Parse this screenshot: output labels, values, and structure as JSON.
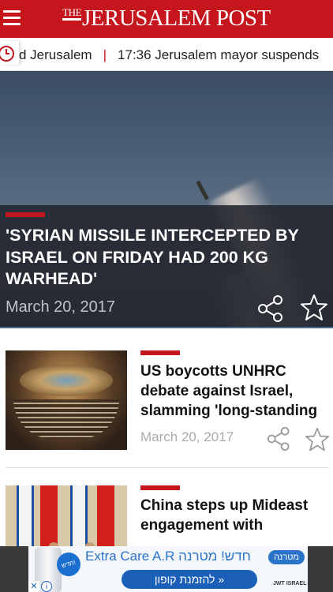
{
  "header": {
    "logo_the": "THE",
    "logo_name": "JERUSALEM POST"
  },
  "ticker": {
    "items": [
      "d Jerusalem",
      "17:36 Jerusalem mayor suspends"
    ]
  },
  "hero": {
    "title": "'Syrian missile intercepted by Israel on Friday had 200 kg warhead'",
    "date": "March 20, 2017"
  },
  "articles": [
    {
      "title": "US boycotts UNHRC debate against Israel, slamming 'long-standing",
      "date": "March 20, 2017"
    },
    {
      "title": "China steps up Mideast engagement with"
    }
  ],
  "ad": {
    "headline": "Extra Care A.R חדש! מטרנה",
    "badge": "חדש!",
    "brand": "מטרנה",
    "button": "להזמנת קופון »",
    "mark": "JWT ISRAEL",
    "close": "✕",
    "info": "i"
  },
  "colors": {
    "brand_red": "#c4161c",
    "ad_blue": "#2a73c9"
  }
}
